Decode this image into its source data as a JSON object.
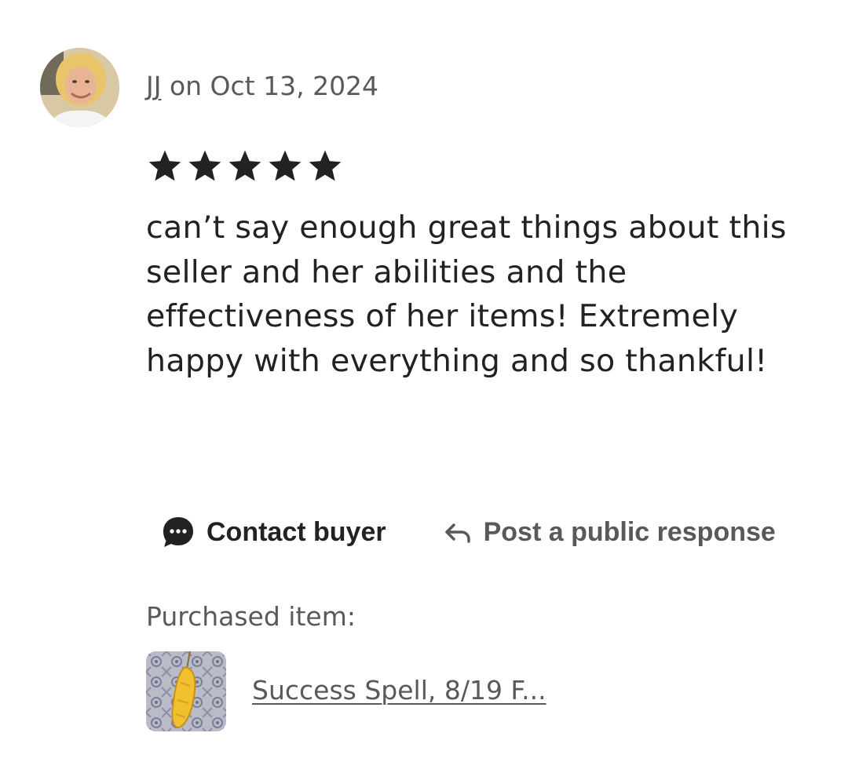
{
  "review": {
    "reviewer_name": "JJ",
    "date_text": " on Oct 13, 2024",
    "rating": 5,
    "rating_max": 5,
    "text": "can’t say enough great things about this seller and her abilities and the effectiveness of her items! Extremely happy with everything and so thankful!"
  },
  "actions": {
    "contact_label": "Contact buyer",
    "contact_icon": "chat-bubble-icon",
    "respond_label": "Post a public response",
    "respond_icon": "reply-arrow-icon"
  },
  "purchase": {
    "label": "Purchased item:",
    "item_title": "Success Spell, 8/19 F..."
  },
  "colors": {
    "text_primary": "#222222",
    "text_secondary": "#595959",
    "background": "#ffffff"
  }
}
